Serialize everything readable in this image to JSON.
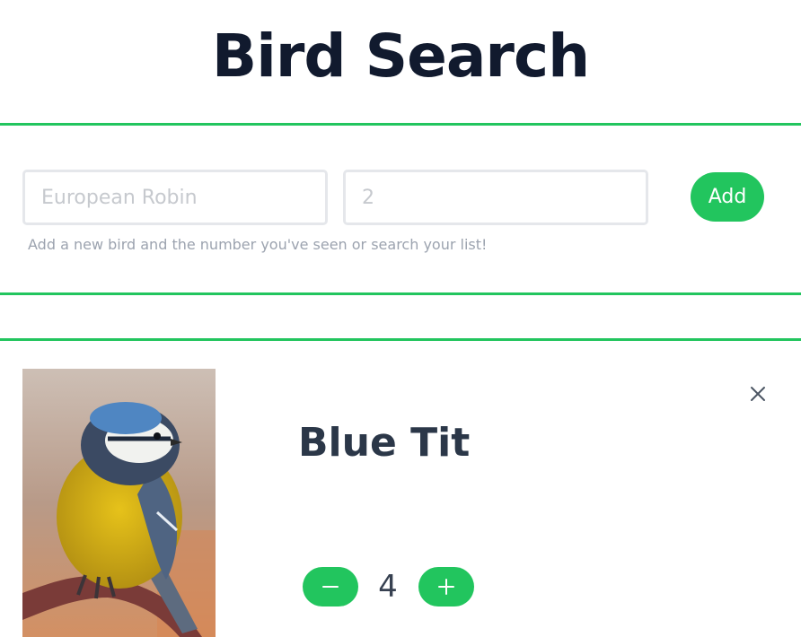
{
  "header": {
    "title": "Bird Search"
  },
  "form": {
    "name_placeholder": "European Robin",
    "count_placeholder": "2",
    "add_label": "Add",
    "hint": "Add a new bird and the number you've seen or search your list!"
  },
  "birds": [
    {
      "name": "Blue Tit",
      "count": "4"
    }
  ],
  "colors": {
    "accent": "#22c55e",
    "title": "#111a2e",
    "card_title": "#2b3748"
  },
  "icons": {
    "close": "close-icon",
    "minus": "minus-icon",
    "plus": "plus-icon"
  }
}
